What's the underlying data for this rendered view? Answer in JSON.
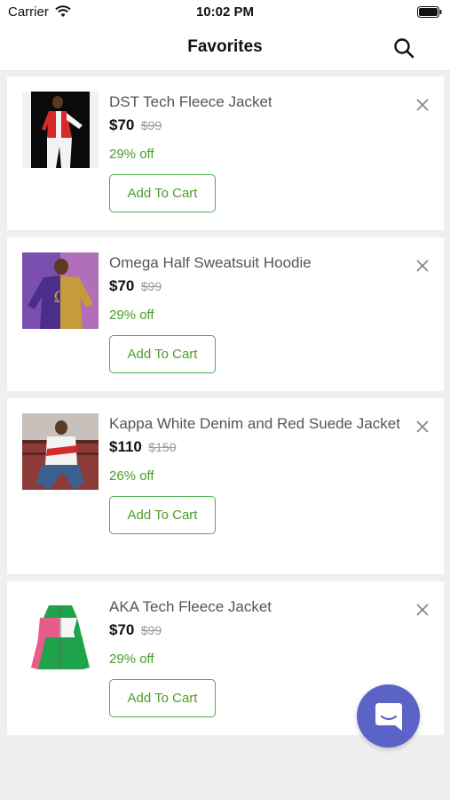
{
  "status_bar": {
    "carrier": "Carrier",
    "time": "10:02 PM"
  },
  "header": {
    "title": "Favorites",
    "search_icon": "search-icon"
  },
  "items": [
    {
      "title": "DST Tech Fleece Jacket",
      "price": "$70",
      "original_price": "$99",
      "discount": "29% off",
      "add_to_cart_label": "Add To Cart"
    },
    {
      "title": "Omega Half Sweatsuit Hoodie",
      "price": "$70",
      "original_price": "$99",
      "discount": "29% off",
      "add_to_cart_label": "Add To Cart"
    },
    {
      "title": "Kappa White Denim and Red Suede Jacket",
      "price": "$110",
      "original_price": "$150",
      "discount": "26% off",
      "add_to_cart_label": "Add To Cart"
    },
    {
      "title": "AKA Tech Fleece Jacket",
      "price": "$70",
      "original_price": "$99",
      "discount": "29% off",
      "add_to_cart_label": "Add To Cart"
    }
  ],
  "colors": {
    "accent_green": "#4a9e2a",
    "chat_fab": "#5b64c6",
    "background": "#efefef"
  },
  "icons": {
    "remove": "close-icon",
    "chat": "chat-icon"
  }
}
